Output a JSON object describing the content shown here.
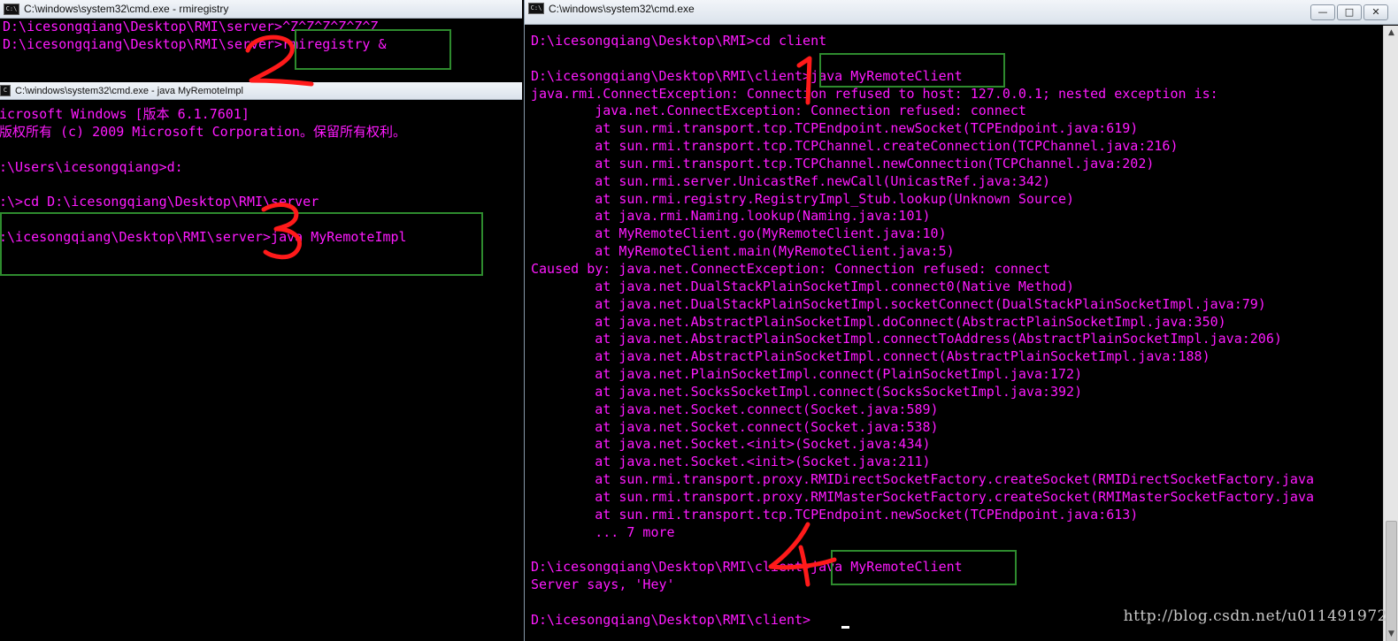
{
  "win1": {
    "title": "C:\\windows\\system32\\cmd.exe - rmiregistry",
    "lines": "D:\\icesongqiang\\Desktop\\RMI\\server>^Z^Z^Z^Z^Z^Z\nD:\\icesongqiang\\Desktop\\RMI\\server>rmiregistry &"
  },
  "win2": {
    "title": "C:\\windows\\system32\\cmd.exe - java  MyRemoteImpl",
    "lines": "icrosoft Windows [版本 6.1.7601]\n版权所有 (c) 2009 Microsoft Corporation。保留所有权利。\n\n:\\Users\\icesongqiang>d:\n\n:\\>cd D:\\icesongqiang\\Desktop\\RMI\\server\n\n:\\icesongqiang\\Desktop\\RMI\\server>java MyRemoteImpl"
  },
  "win3": {
    "title": "C:\\windows\\system32\\cmd.exe",
    "lines": "D:\\icesongqiang\\Desktop\\RMI>cd client\n\nD:\\icesongqiang\\Desktop\\RMI\\client>java MyRemoteClient\njava.rmi.ConnectException: Connection refused to host: 127.0.0.1; nested exception is:\n        java.net.ConnectException: Connection refused: connect\n        at sun.rmi.transport.tcp.TCPEndpoint.newSocket(TCPEndpoint.java:619)\n        at sun.rmi.transport.tcp.TCPChannel.createConnection(TCPChannel.java:216)\n        at sun.rmi.transport.tcp.TCPChannel.newConnection(TCPChannel.java:202)\n        at sun.rmi.server.UnicastRef.newCall(UnicastRef.java:342)\n        at sun.rmi.registry.RegistryImpl_Stub.lookup(Unknown Source)\n        at java.rmi.Naming.lookup(Naming.java:101)\n        at MyRemoteClient.go(MyRemoteClient.java:10)\n        at MyRemoteClient.main(MyRemoteClient.java:5)\nCaused by: java.net.ConnectException: Connection refused: connect\n        at java.net.DualStackPlainSocketImpl.connect0(Native Method)\n        at java.net.DualStackPlainSocketImpl.socketConnect(DualStackPlainSocketImpl.java:79)\n        at java.net.AbstractPlainSocketImpl.doConnect(AbstractPlainSocketImpl.java:350)\n        at java.net.AbstractPlainSocketImpl.connectToAddress(AbstractPlainSocketImpl.java:206)\n        at java.net.AbstractPlainSocketImpl.connect(AbstractPlainSocketImpl.java:188)\n        at java.net.PlainSocketImpl.connect(PlainSocketImpl.java:172)\n        at java.net.SocksSocketImpl.connect(SocksSocketImpl.java:392)\n        at java.net.Socket.connect(Socket.java:589)\n        at java.net.Socket.connect(Socket.java:538)\n        at java.net.Socket.<init>(Socket.java:434)\n        at java.net.Socket.<init>(Socket.java:211)\n        at sun.rmi.transport.proxy.RMIDirectSocketFactory.createSocket(RMIDirectSocketFactory.java\n        at sun.rmi.transport.proxy.RMIMasterSocketFactory.createSocket(RMIMasterSocketFactory.java\n        at sun.rmi.transport.tcp.TCPEndpoint.newSocket(TCPEndpoint.java:613)\n        ... 7 more\n\nD:\\icesongqiang\\Desktop\\RMI\\client>java MyRemoteClient\nServer says, 'Hey'\n\nD:\\icesongqiang\\Desktop\\RMI\\client>",
    "minimize": "—",
    "maximize": "□",
    "close": "✕"
  },
  "watermark": "http://blog.csdn.net/u011491972",
  "colors": {
    "console_text": "#ff1aff",
    "highlight_box": "#2e8b2e",
    "annotation": "#ff1a1a"
  }
}
